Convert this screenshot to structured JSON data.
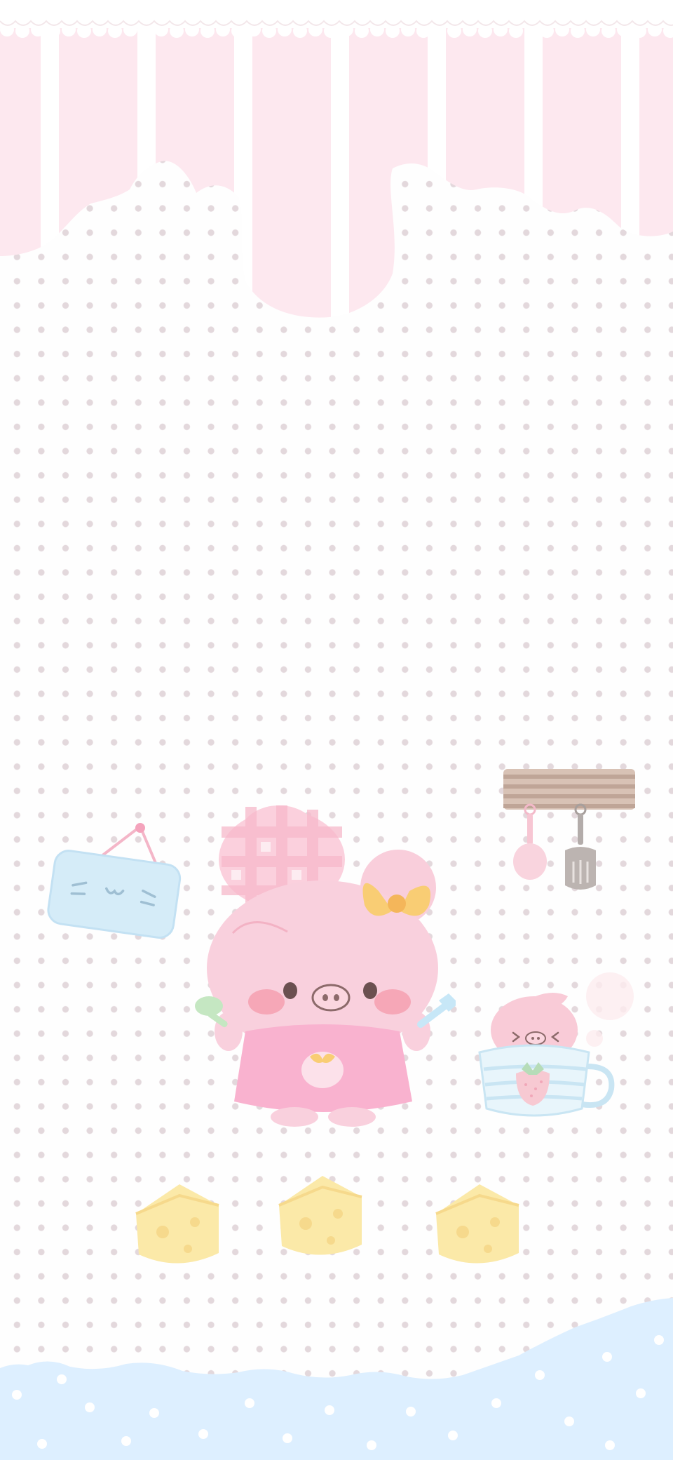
{
  "wallpaper": {
    "kind": "pastel phone lock-screen wallpaper",
    "background": "#fefefe",
    "dot_color": "#e3d8dc",
    "colors": {
      "stripe_pink": "#fde8ef",
      "lace_white": "#ffffff",
      "pig_pink": "#f8c8d6",
      "pig_cheek": "#f6a7b7",
      "dress_pink": "#f9b2cf",
      "bow_yellow": "#f8d27e",
      "sign_blue": "#d5ecf8",
      "cheese_yellow": "#fbe9a8",
      "wave_blue": "#ddefff",
      "rack_brown": "#c7b0a2",
      "spoon_green": "#c5e7c2",
      "fork_blue": "#c7e7f7"
    },
    "characters": [
      {
        "name": "main-pig",
        "description_icon": "pig-chef-icon"
      },
      {
        "name": "cup-pig",
        "description_icon": "pig-in-teacup-icon"
      }
    ],
    "props": [
      "hanging-sign-icon",
      "utensil-rack-icon",
      "cheese-icon",
      "cheese-icon",
      "cheese-icon",
      "steam-cloud-icon"
    ]
  }
}
